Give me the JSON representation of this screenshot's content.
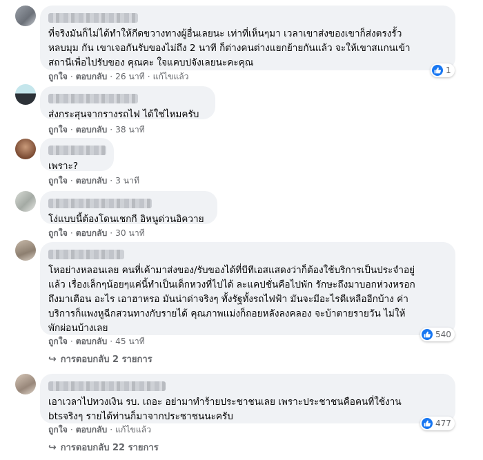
{
  "labels": {
    "like": "ถูกใจ",
    "reply": "ตอบกลับ",
    "edited": "แก้ไขแล้ว",
    "dot": "·"
  },
  "colors": {
    "bubble": "#f0f2f5",
    "meta": "#65676b",
    "like_badge": "#1877f2"
  },
  "comments": [
    {
      "text": "ที่จริงมันก็ไม่ได้ทำให้กีดขวางทางผู้อื่นเลยนะ เท่าที่เห็นๆมา เวลาเขาส่งของเขาก็ส่งตรงรั้ว\nหลบมุม กัน เขาเจอกันรับของไม่ถึง 2 นาที ก็ต่างคนต่างแยกย้ายกันแล้ว จะให้เขาสแกนเข้า\nสถานีเพื่อไปรับของ คุณคะ ใจแคบปจังเลยนะคะคุณ",
      "time": "26 นาที",
      "edited": true,
      "likes": "1"
    },
    {
      "text": "ส่งกระสุนจากรางรถไฟ ได้ใช่ไหมครับ",
      "time": "38 นาที",
      "edited": false,
      "likes": null
    },
    {
      "text": "เพราะ?",
      "time": "3 นาที",
      "edited": false,
      "likes": null
    },
    {
      "text": "โง่แบบนี้ต้องโดนเชกกี อิหนูด่วนอิควาย",
      "time": "30 นาที",
      "edited": false,
      "likes": null
    },
    {
      "text": "โหอย่างหลอนเลย คนที่เค้ามาส่งของ/รับของได้ที่บีทีเอสแสดงว่าก็ต้องใช้บริการเป็นประจำอยู่\nแล้ว เรื่องเล็กๆน้อยๆแค่นี้ทำเป็นเด็กหวงที่ไปได้ ละแคปชั่นคือไปพัก รักษะถึงมาบอกห่วงหรอก\nถึงมาเตือน อะไร เอาฮาหรอ มันน่าด่าจริงๆ ทั้งรัฐทั้งรถไฟฟ้า มันจะมีอะไรดีเหลืออีกบ้าง ค่า\nบริการก็แพงหูฉีกสวนทางกับรายได้ คุณภาพแม่งก็ถอยหลังลงคลอง จะบ้าตายรายวัน ไม่ให้\nพักผ่อนบ้างเลย",
      "time": "45 นาที",
      "edited": false,
      "likes": "540",
      "replies": "การตอบกลับ 2 รายการ"
    },
    {
      "text": "เอาเวลาไปทวงเงิน รบ. เถอะ อย่ามาทำร้ายประชาชนเลย เพราะประชาชนคือคนที่ใช้งาน\nbtsจริงๆ รายได้ท่านก็มาจากประชาชนนะครับ",
      "time": "",
      "edited": true,
      "likes": "477",
      "replies": "การตอบกลับ 22 รายการ"
    }
  ]
}
